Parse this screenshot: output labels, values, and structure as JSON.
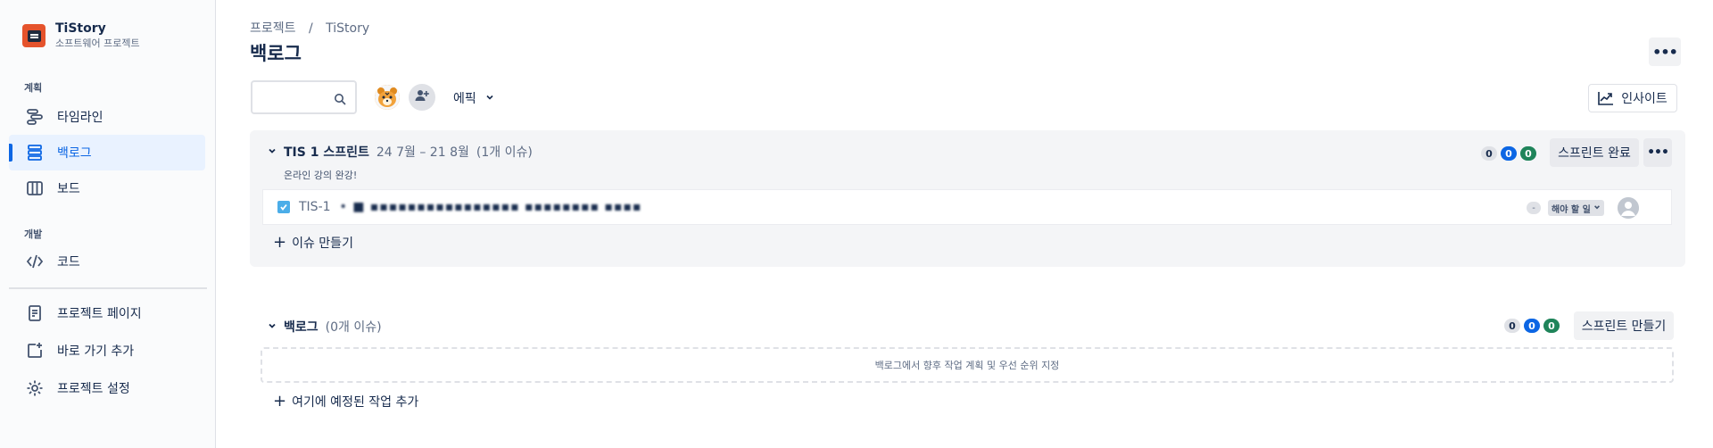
{
  "project": {
    "name": "TiStory",
    "type": "소프트웨어 프로젝트"
  },
  "sidebar": {
    "section_planning": "계획",
    "section_dev": "개발",
    "items": [
      {
        "label": "타임라인",
        "icon": "timeline-icon"
      },
      {
        "label": "백로그",
        "icon": "backlog-icon",
        "active": true
      },
      {
        "label": "보드",
        "icon": "board-icon"
      },
      {
        "label": "코드",
        "icon": "code-icon"
      },
      {
        "label": "프로젝트 페이지",
        "icon": "page-icon"
      },
      {
        "label": "바로 가기 추가",
        "icon": "add-shortcut-icon"
      },
      {
        "label": "프로젝트 설정",
        "icon": "gear-icon"
      }
    ]
  },
  "breadcrumb": {
    "root": "프로젝트",
    "sep": "/",
    "current": "TiStory"
  },
  "page_title": "백로그",
  "toolbar": {
    "epic_label": "에픽",
    "insight_label": "인사이트"
  },
  "sprint": {
    "name": "TIS 1 스프린트",
    "dates": "24 7월 – 21 8월",
    "count": "(1개 이슈)",
    "goal": "온라인 강의 완강!",
    "counts": [
      "0",
      "0",
      "0"
    ],
    "complete_label": "스프린트 완료",
    "issue": {
      "key": "TIS-1",
      "summary": "• ■ ▪▪▪▪▪▪▪▪▪▪▪▪▪▪▪▪ ▪▪▪▪▪▪▪▪ ▪▪▪▪",
      "estimate": "-",
      "status": "해야 할 일"
    },
    "create_issue_label": "이슈 만들기"
  },
  "backlog": {
    "name": "백로그",
    "count": "(0개 이슈)",
    "counts": [
      "0",
      "0",
      "0"
    ],
    "create_sprint_label": "스프린트 만들기",
    "empty_text": "백로그에서 향후 작업 계획 및 우선 순위 지정",
    "add_planned_label": "여기에 예정된 작업 추가"
  },
  "colors": {
    "accent": "#0c66e4",
    "done": "#1f845a",
    "logo": "#e5532c"
  }
}
